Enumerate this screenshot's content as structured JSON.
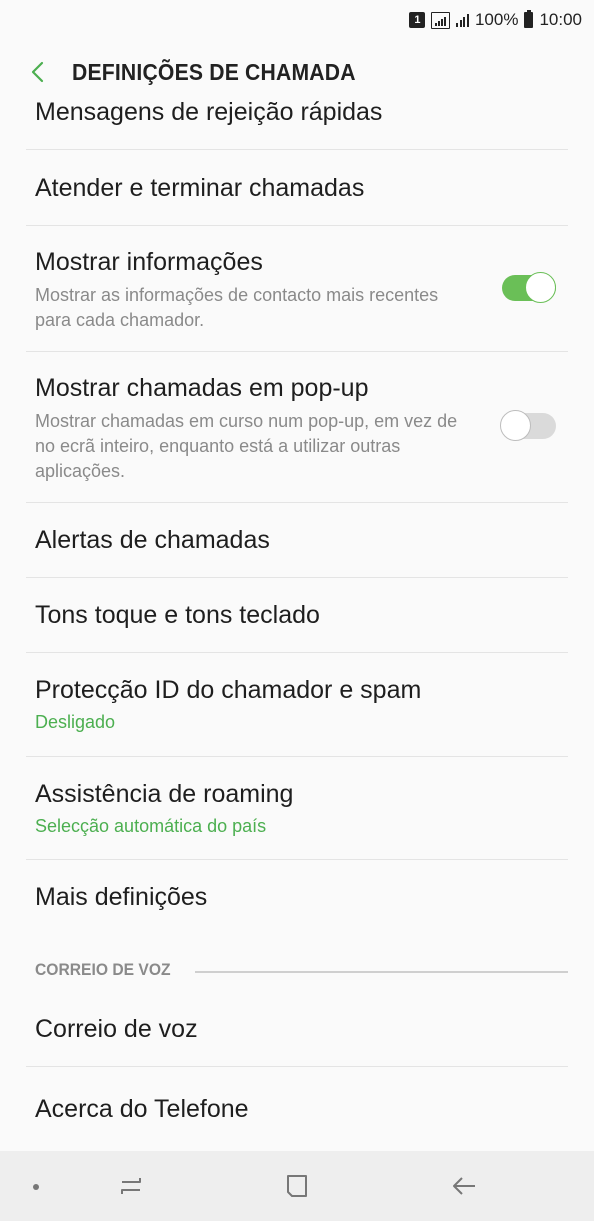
{
  "status_bar": {
    "sim": "1",
    "battery": "100%",
    "time": "10:00"
  },
  "header": {
    "title": "DEFINIÇÕES DE CHAMADA"
  },
  "items": [
    {
      "title": "Mensagens de rejeição rápidas"
    },
    {
      "title": "Atender e terminar chamadas"
    },
    {
      "title": "Mostrar informações",
      "sub": "Mostrar as informações de contacto mais recentes para cada chamador.",
      "toggle": true
    },
    {
      "title": "Mostrar chamadas em pop-up",
      "sub": "Mostrar chamadas em curso num pop-up, em vez de no ecrã inteiro, enquanto está a utilizar outras aplicações.",
      "toggle": false
    },
    {
      "title": "Alertas de chamadas"
    },
    {
      "title": "Tons toque e tons teclado"
    },
    {
      "title": "Protecção ID do chamador e spam",
      "sub": "Desligado"
    },
    {
      "title": "Assistência de roaming",
      "sub": "Selecção automática do país"
    },
    {
      "title": "Mais definições"
    }
  ],
  "voicemail_section": {
    "header": "CORREIO DE VOZ",
    "items": [
      {
        "title": "Correio de voz"
      },
      {
        "title": "Acerca do Telefone"
      }
    ]
  },
  "colors": {
    "accent": "#4caf50",
    "toggle_on": "#6abf57",
    "toggle_off": "#dadada"
  },
  "icons": {
    "back": "chevron-left-icon",
    "nav_recents": "recents-icon",
    "nav_home": "home-icon",
    "nav_back": "back-arrow-icon"
  }
}
